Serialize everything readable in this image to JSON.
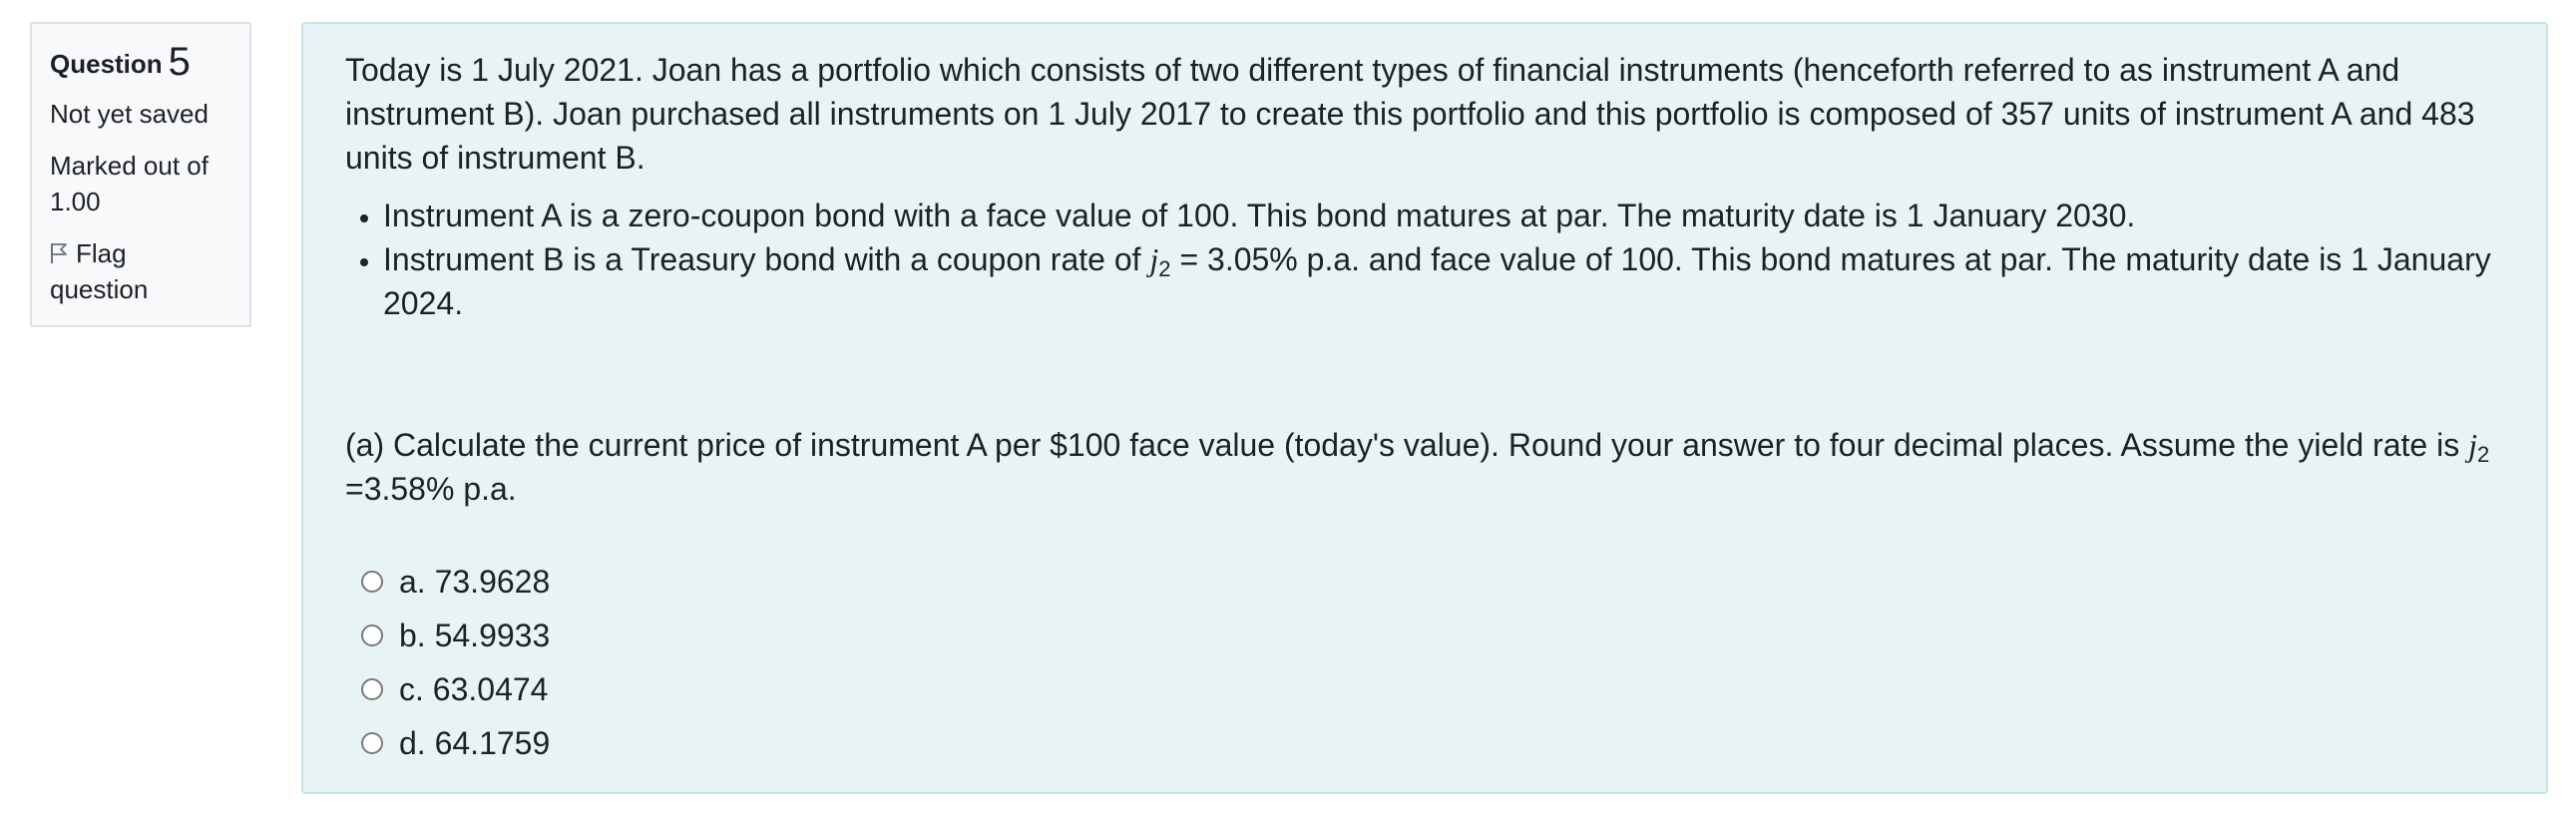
{
  "info": {
    "question_label": "Question",
    "question_number": "5",
    "state": "Not yet saved",
    "grade_line1": "Marked out of",
    "grade_line2": "1.00",
    "flag_line1": "Flag",
    "flag_line2": "question",
    "flag_icon": "flag-outline-icon"
  },
  "question": {
    "intro": "Today is 1 July 2021. Joan has a portfolio which consists of two different types of financial instruments (henceforth referred to as instrument A and instrument B). Joan purchased all instruments on 1 July 2017 to create this portfolio and this portfolio is composed of 357 units of instrument A and 483 units of instrument B.",
    "bullet_a": "Instrument A is a zero-coupon bond with a face value of 100. This bond matures at par. The maturity date is 1 January 2030.",
    "bullet_b_pre": "Instrument B is a Treasury bond with a coupon rate of ",
    "bullet_b_var": "j",
    "bullet_b_sub": "2",
    "bullet_b_post": " = 3.05% p.a. and face value of 100. This bond matures at par. The maturity date is 1 January 2024.",
    "part_a_pre": "(a) Calculate the current price of instrument A per $100 face value (today's value). Round your answer to four decimal places. Assume the yield rate is ",
    "part_a_var": "j",
    "part_a_sub": "2",
    "part_a_post": " =3.58% p.a."
  },
  "answers": [
    {
      "label": "a. 73.9628"
    },
    {
      "label": "b. 54.9933"
    },
    {
      "label": "c. 63.0474"
    },
    {
      "label": "d. 64.1759"
    }
  ]
}
